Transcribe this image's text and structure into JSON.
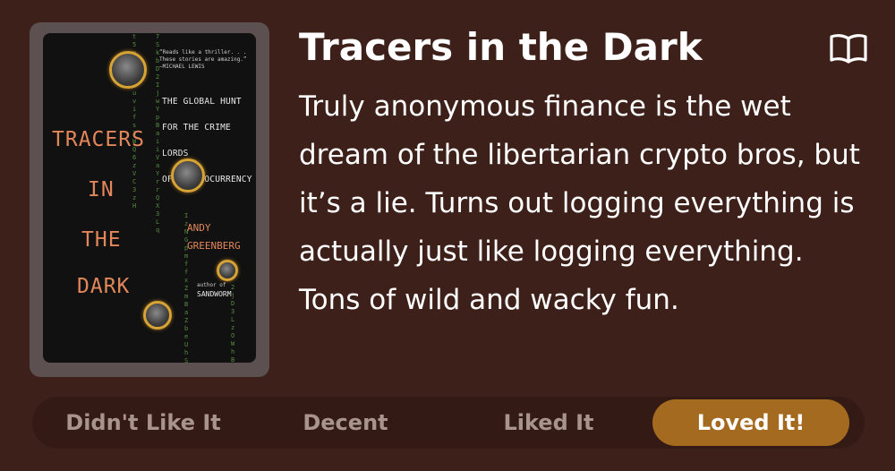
{
  "book": {
    "title": "Tracers in the Dark",
    "review": "Truly anonymous finance is the wet dream of the libertarian crypto bros, but it’s a lie. Turns out logging everything is actually just like logging everything. Tons of wild and wacky fun.",
    "cover": {
      "blurb": "“Reads like a thriller. . . These stories are amazing.” —MICHAEL LEWIS",
      "subtitle_lines": [
        "THE GLOBAL HUNT",
        "FOR THE CRIME LORDS",
        "OF CRYPTOCURRENCY"
      ],
      "title_words": [
        "TRACERS",
        "IN",
        "THE",
        "DARK"
      ],
      "author_lines": [
        "ANDY",
        "GREENBERG"
      ],
      "author_of": "author of",
      "previous_book": "SANDWORM",
      "code_columns": [
        "t5e4I1E uvifs3WQ 6zVC3zH",
        "7SkbD2IjwYpBaiiVaYrrQX3Lq",
        "IzNGpmffxZmBaZbeUhSc",
        "2jD3LzOWhBDG"
      ]
    }
  },
  "actions": {
    "book_icon": "book-open-icon"
  },
  "rating": {
    "options": [
      "Didn't Like It",
      "Decent",
      "Liked It",
      "Loved It!"
    ],
    "selected": "Loved It!"
  },
  "colors": {
    "background": "#3d2019",
    "rating_bar": "#341a14",
    "selected_pill": "#a46a20",
    "inactive_text": "#a8948d",
    "cover_title": "#e2875a",
    "code_green": "#5f9a47",
    "coin_gold": "#d7a335"
  }
}
